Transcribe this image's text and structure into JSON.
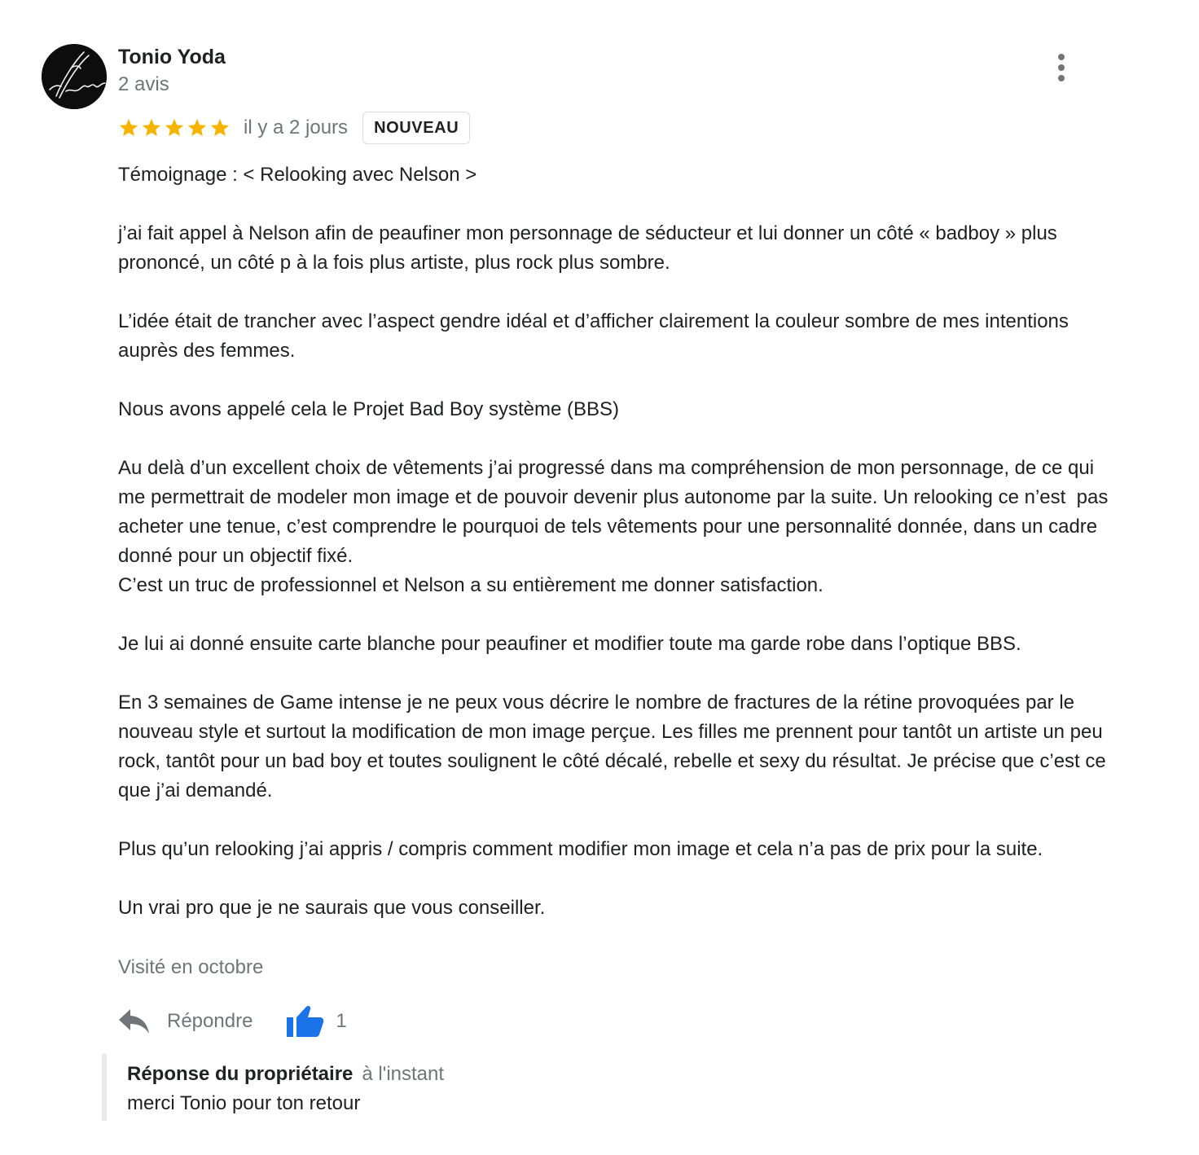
{
  "author": {
    "name": "Tonio Yoda",
    "reviews_count": "2 avis",
    "avatar_icon": "signature-avatar-icon"
  },
  "rating": {
    "stars": 5,
    "star_color": "#f4b400",
    "time_ago": "il y a 2 jours",
    "badge": "NOUVEAU"
  },
  "review": {
    "paragraphs": [
      "Témoignage : < Relooking avec Nelson >",
      "j’ai fait appel à Nelson afin de peaufiner mon personnage de séducteur et lui donner un côté « badboy » plus prononcé, un côté p à la fois plus artiste, plus rock plus sombre.",
      "L’idée était de trancher avec l’aspect gendre idéal et d’afficher clairement la couleur sombre de mes intentions auprès des femmes.",
      "Nous avons appelé cela le Projet Bad Boy système (BBS)",
      "Au delà d’un excellent choix de vêtements j’ai progressé dans ma compréhension de mon personnage, de ce qui me permettrait de modeler mon image et de pouvoir devenir plus autonome par la suite. Un relooking ce n’est  pas acheter une tenue, c’est comprendre le pourquoi de tels vêtements pour une personnalité donnée, dans un cadre donné pour un objectif fixé.\nC’est un truc de professionnel et Nelson a su entièrement me donner satisfaction.",
      "Je lui ai donné ensuite carte blanche pour peaufiner et modifier toute ma garde robe dans l’optique BBS.",
      "En 3 semaines de Game intense je ne peux vous décrire le nombre de fractures de la rétine provoquées par le nouveau style et surtout la modification de mon image perçue. Les filles me prennent pour tantôt un artiste un peu rock, tantôt pour un bad boy et toutes soulignent le côté décalé, rebelle et sexy du résultat. Je précise que c’est ce que j’ai demandé.",
      "Plus qu’un relooking j’ai appris / compris comment modifier mon image et cela n’a pas de prix pour la suite.",
      "Un vrai pro que je ne saurais que vous conseiller."
    ],
    "visited": "Visité en octobre"
  },
  "actions": {
    "reply_label": "Répondre",
    "reply_icon": "reply-arrow-icon",
    "like_icon": "thumbs-up-icon",
    "like_color": "#1a73e8",
    "like_count": "1",
    "more_icon": "more-vertical-icon"
  },
  "owner_reply": {
    "title": "Réponse du propriétaire",
    "time": "à l'instant",
    "text": "merci Tonio pour ton retour"
  }
}
